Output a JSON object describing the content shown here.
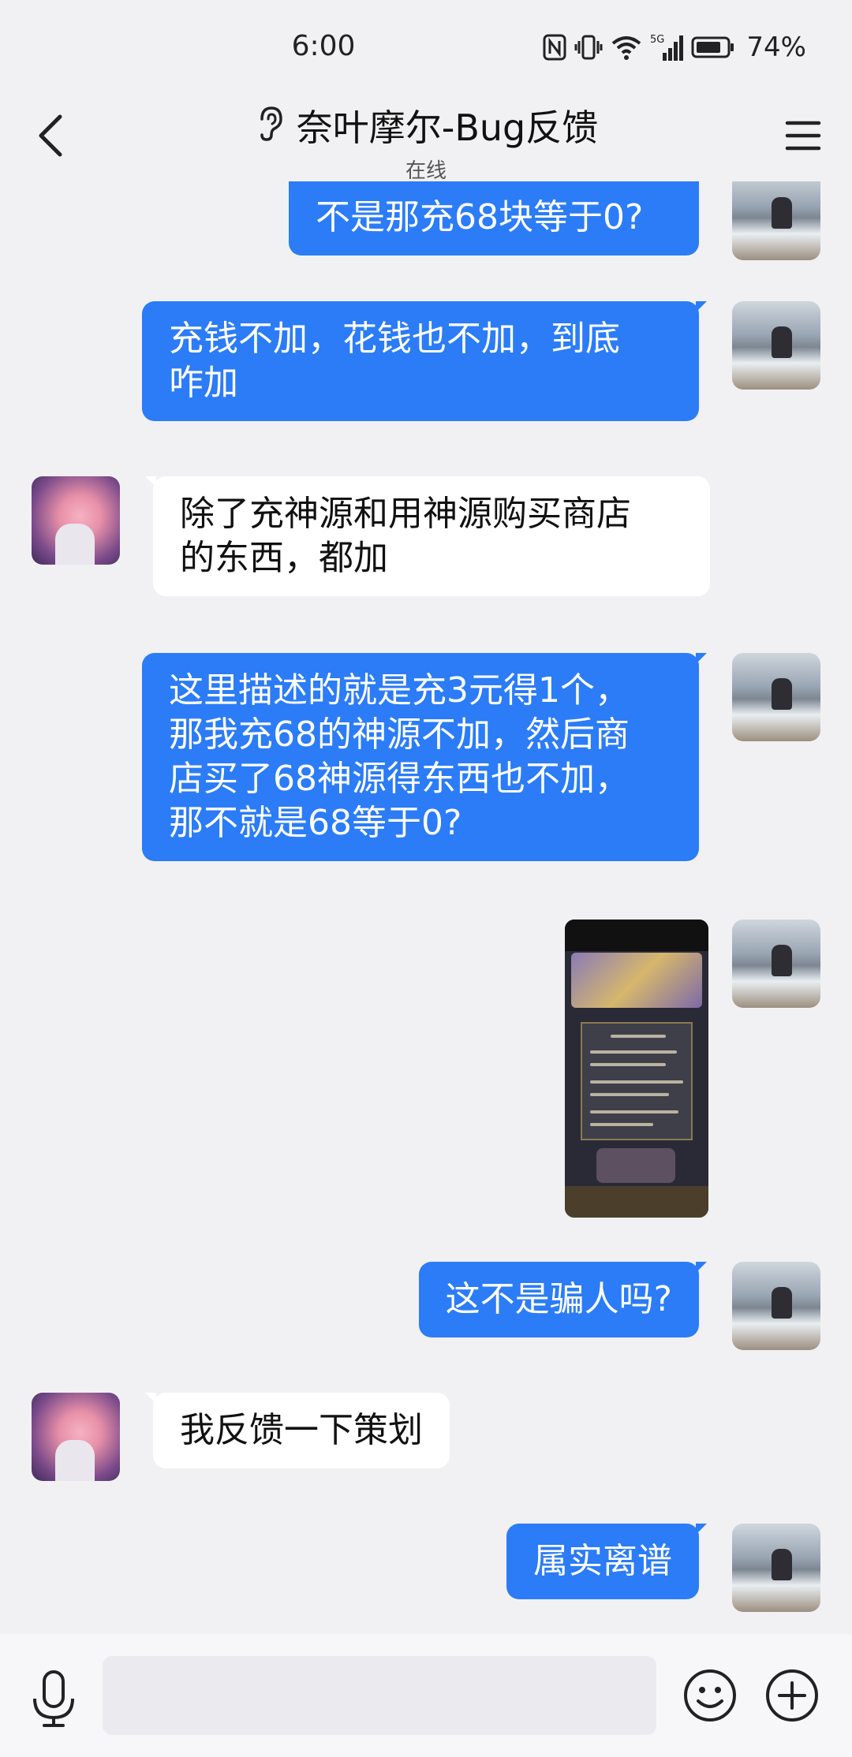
{
  "status_bar": {
    "time": "6:00",
    "network": "5G",
    "battery": "74%",
    "icons": [
      "nfc-icon",
      "vibrate-icon",
      "wifi-icon",
      "signal-icon",
      "battery-icon"
    ]
  },
  "header": {
    "title": "奈叶摩尔-Bug反馈",
    "subtitle": "在线",
    "icons": [
      "back-chevron-icon",
      "ear-icon",
      "menu-icon"
    ]
  },
  "messages": [
    {
      "sender": "self",
      "type": "text",
      "lines": [
        "不是那充68块等于0?"
      ]
    },
    {
      "sender": "self",
      "type": "text",
      "lines": [
        "充钱不加，花钱也不加，到底",
        "咋加"
      ]
    },
    {
      "sender": "other",
      "type": "text",
      "lines": [
        "除了充神源和用神源购买商店",
        "的东西，都加"
      ]
    },
    {
      "sender": "self",
      "type": "text",
      "lines": [
        "这里描述的就是充3元得1个，",
        "那我充68的神源不加，然后商",
        "店买了68神源得东西也不加，",
        "那不就是68等于0?"
      ]
    },
    {
      "sender": "self",
      "type": "image"
    },
    {
      "sender": "self",
      "type": "text",
      "lines": [
        "这不是骗人吗?"
      ]
    },
    {
      "sender": "other",
      "type": "text",
      "lines": [
        "我反馈一下策划"
      ]
    },
    {
      "sender": "self",
      "type": "text",
      "lines": [
        "属实离谱"
      ]
    }
  ],
  "input_bar": {
    "placeholder": "",
    "icons": [
      "microphone-icon",
      "emoji-icon",
      "plus-icon"
    ]
  },
  "colors": {
    "background": "#f1f1f3",
    "self_bubble": "#2b7cf6",
    "other_bubble": "#ffffff"
  }
}
